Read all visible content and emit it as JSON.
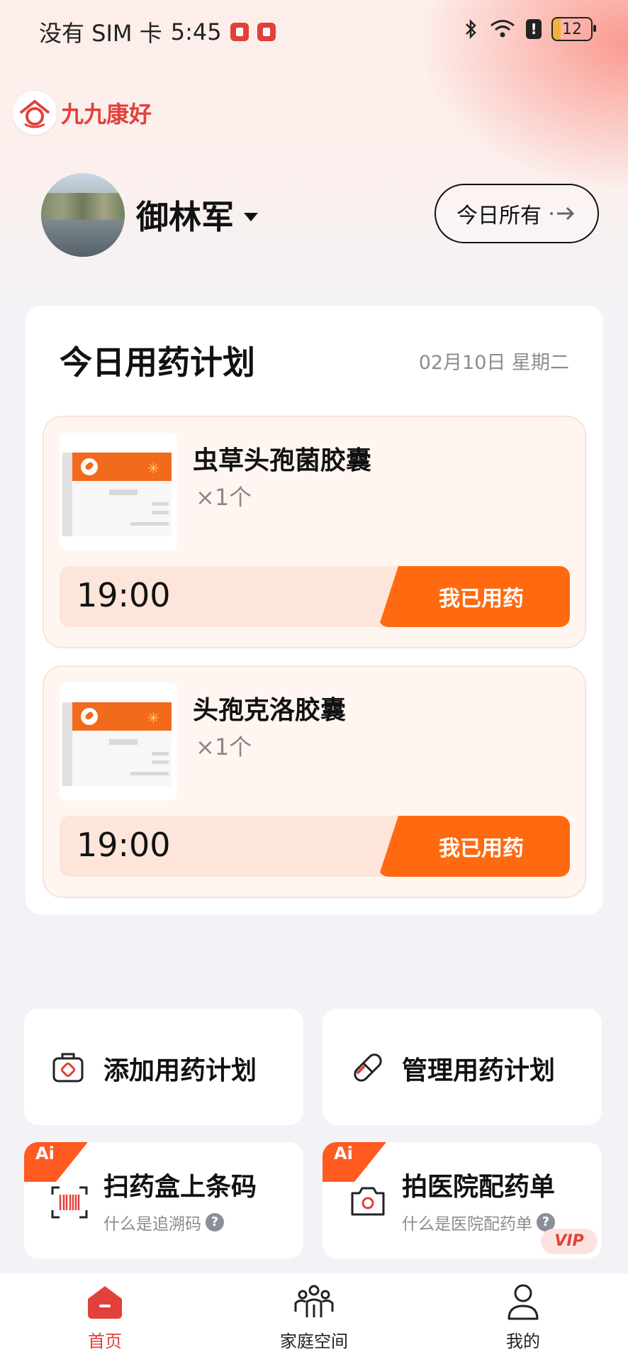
{
  "status_bar": {
    "carrier": "没有 SIM 卡",
    "time": "5:45",
    "battery": "12"
  },
  "app": {
    "name": "九九康好"
  },
  "user": {
    "name": "御林军"
  },
  "header": {
    "today_all_label": "今日所有"
  },
  "plan": {
    "title": "今日用药计划",
    "date": "02月10日 星期二",
    "items": [
      {
        "name": "虫草头孢菌胶囊",
        "qty": "×1个",
        "time": "19:00",
        "button": "我已用药"
      },
      {
        "name": "头孢克洛胶囊",
        "qty": "×1个",
        "time": "19:00",
        "button": "我已用药"
      }
    ]
  },
  "actions": {
    "add": "添加用药计划",
    "manage": "管理用药计划",
    "scan": {
      "title": "扫药盒上条码",
      "sub": "什么是追溯码",
      "tag": "Ai"
    },
    "photo": {
      "title": "拍医院配药单",
      "sub": "什么是医院配药单",
      "tag": "Ai",
      "badge": "VIP"
    },
    "help_mark": "?"
  },
  "nav": {
    "home": "首页",
    "family": "家庭空间",
    "mine": "我的"
  },
  "colors": {
    "brand": "#e2403a",
    "accent": "#ff6a10",
    "card_bg": "#fff6f1"
  }
}
